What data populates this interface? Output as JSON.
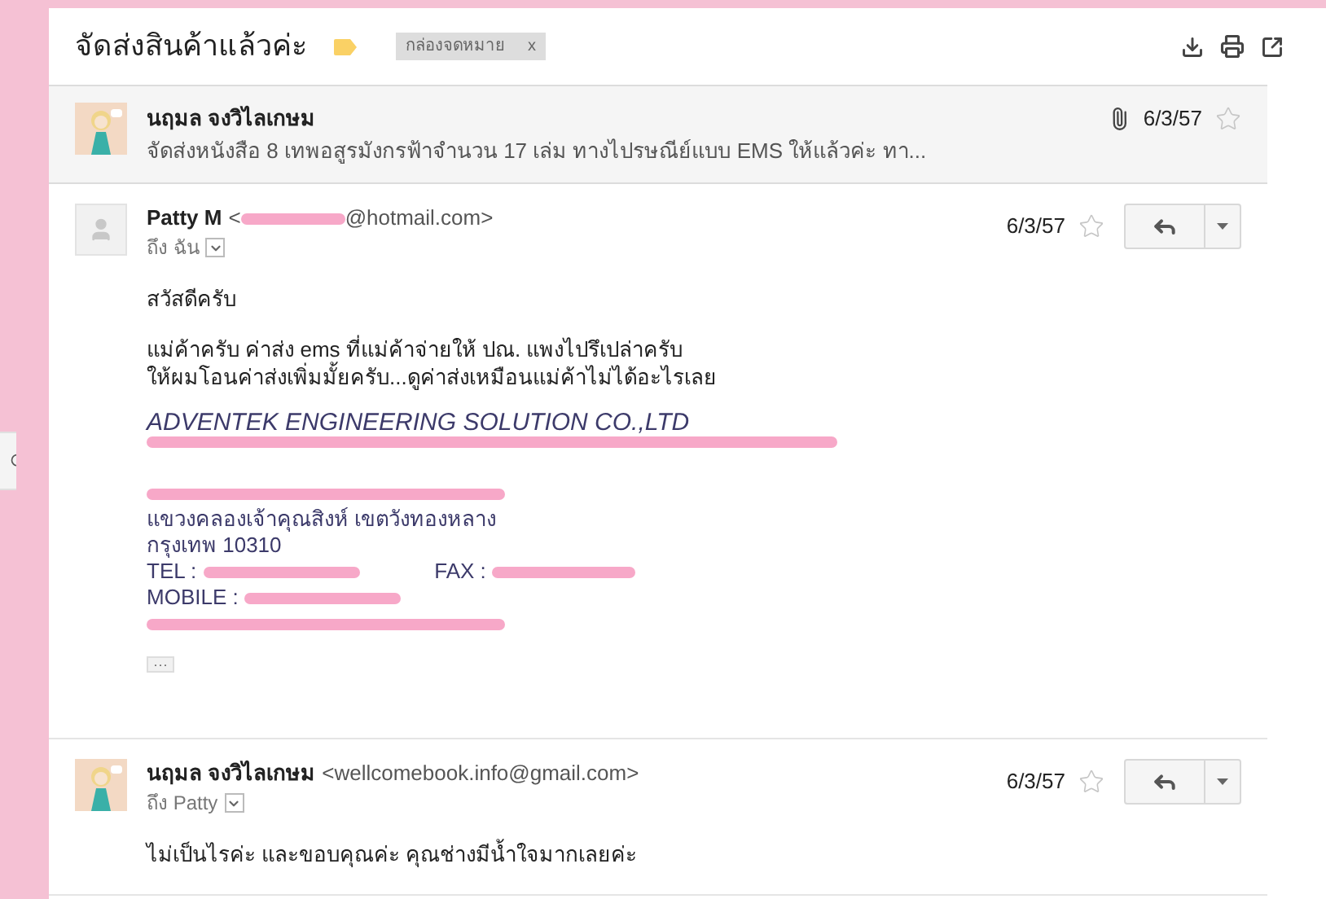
{
  "thread": {
    "subject": "จัดส่งสินค้าแล้วค่ะ",
    "label": "กล่องจดหมาย",
    "label_close": "x"
  },
  "messages": [
    {
      "kind": "collapsed",
      "sender": "นฤมล จงวิไลเกษม",
      "snippet": "จัดส่งหนังสือ 8 เทพอสูรมังกรฟ้าจำนวน 17 เล่ม ทางไปรษณีย์แบบ EMS ให้แล้วค่ะ ทา...",
      "date": "6/3/57",
      "attachment": true,
      "starred": false
    },
    {
      "kind": "expanded",
      "sender": "Patty M",
      "email_before": "<",
      "email_redacted": true,
      "email_after": "@hotmail.com>",
      "to": "ถึง ฉัน",
      "date": "6/3/57",
      "starred": false,
      "avatar": {
        "kind": "default"
      },
      "body": [
        {
          "kind": "text",
          "text": "สวัสดีครับ"
        },
        {
          "kind": "text",
          "text": "แม่ค้าครับ ค่าส่ง ems ที่แม่ค้าจ่ายให้ ปณ. แพงไปรึเปล่าครับ"
        },
        {
          "kind": "text",
          "text": "ให้ผมโอนค่าส่งเพิ่มมั้ยครับ...ดูค่าส่งเหมือนแม่ค้าไม่ได้อะไรเลย"
        },
        {
          "kind": "company",
          "text": "ADVENTEK ENGINEERING SOLUTION CO.,LTD"
        },
        {
          "kind": "redacted"
        },
        {
          "kind": "signature",
          "text": "แขวงคลองเจ้าคุณสิงห์ เขตวังทองหลาง"
        },
        {
          "kind": "signature",
          "text": "กรุงเทพ 10310"
        },
        {
          "kind": "pair",
          "label": "TEL :",
          "label2": "FAX :"
        },
        {
          "kind": "field",
          "label": "MOBILE :"
        },
        {
          "kind": "redacted"
        }
      ],
      "more": "···"
    },
    {
      "kind": "expanded",
      "sender": "นฤมล จงวิไลเกษม",
      "email_before": "<wellcomebook.info@gmail.com>",
      "email_redacted": false,
      "to": "ถึง Patty",
      "date": "6/3/57",
      "starred": false,
      "body": [
        {
          "kind": "text",
          "text": "ไม่เป็นไรค่ะ และขอบคุณค่ะ คุณช่างมีน้ำใจมากเลยค่ะ"
        }
      ]
    }
  ]
}
